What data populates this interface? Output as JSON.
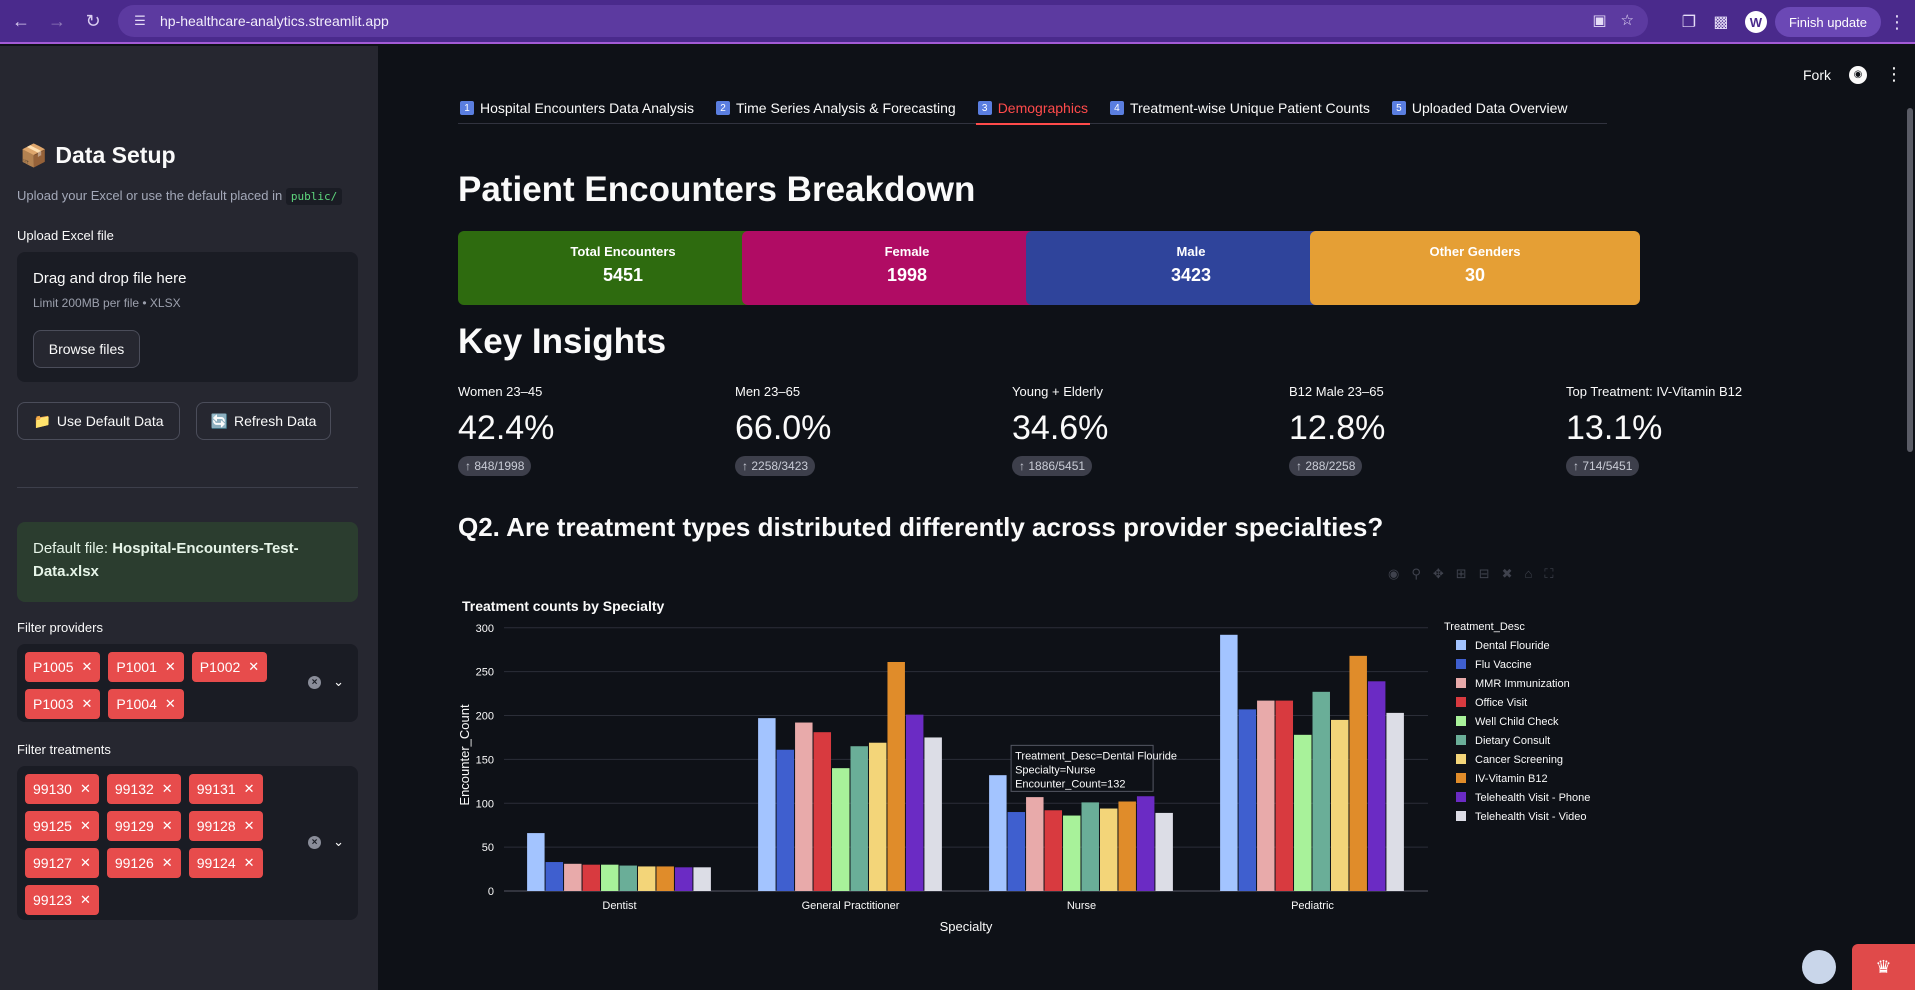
{
  "browser": {
    "url": "hp-healthcare-analytics.streamlit.app",
    "avatar_letter": "W",
    "finish_update": "Finish update"
  },
  "sidebar": {
    "title": "Data Setup",
    "caption": "Upload your Excel or use the default placed in",
    "caption_code": "public/",
    "upload_label": "Upload Excel file",
    "dropzone_title": "Drag and drop file here",
    "dropzone_limit": "Limit 200MB per file • XLSX",
    "browse_label": "Browse files",
    "use_default_label": "Use Default Data",
    "refresh_label": "Refresh Data",
    "default_file_prefix": "Default file:",
    "default_file_name": "Hospital-Encounters-Test-Data.xlsx",
    "filter_providers_label": "Filter providers",
    "providers": [
      "P1005",
      "P1001",
      "P1002",
      "P1003",
      "P1004"
    ],
    "filter_treatments_label": "Filter treatments",
    "treatments": [
      "99130",
      "99132",
      "99131",
      "99125",
      "99129",
      "99128",
      "99127",
      "99126",
      "99124",
      "99123"
    ]
  },
  "topbar": {
    "fork": "Fork"
  },
  "tabs": [
    {
      "num": "1",
      "label": "Hospital Encounters Data Analysis"
    },
    {
      "num": "2",
      "label": "Time Series Analysis & Forecasting"
    },
    {
      "num": "3",
      "label": "Demographics"
    },
    {
      "num": "4",
      "label": "Treatment-wise Unique Patient Counts"
    },
    {
      "num": "5",
      "label": "Uploaded Data Overview"
    }
  ],
  "main": {
    "heading": "Patient Encounters Breakdown",
    "cards": [
      {
        "label": "Total Encounters",
        "value": "5451",
        "color": "#2e6b0f"
      },
      {
        "label": "Female",
        "value": "1998",
        "color": "#b00c64"
      },
      {
        "label": "Male",
        "value": "3423",
        "color": "#2f449b"
      },
      {
        "label": "Other Genders",
        "value": "30",
        "color": "#e59f35"
      }
    ],
    "insights_heading": "Key Insights",
    "metrics": [
      {
        "label": "Women 23–45",
        "value": "42.4%",
        "delta": "848/1998"
      },
      {
        "label": "Men 23–65",
        "value": "66.0%",
        "delta": "2258/3423"
      },
      {
        "label": "Young + Elderly",
        "value": "34.6%",
        "delta": "1886/5451"
      },
      {
        "label": "B12 Male 23–65",
        "value": "12.8%",
        "delta": "288/2258"
      },
      {
        "label": "Top Treatment: IV-Vitamin B12",
        "value": "13.1%",
        "delta": "714/5451"
      }
    ],
    "question": "Q2. Are treatment types distributed differently across provider specialties?"
  },
  "chart_data": {
    "type": "bar",
    "title": "Treatment counts by Specialty",
    "xlabel": "Specialty",
    "ylabel": "Encounter_Count",
    "legend_title": "Treatment_Desc",
    "ylim": [
      0,
      310
    ],
    "yticks": [
      0,
      50,
      100,
      150,
      200,
      250,
      300
    ],
    "categories": [
      "Dentist",
      "General Practitioner",
      "Nurse",
      "Pediatric"
    ],
    "series": [
      {
        "name": "Dental Flouride",
        "color": "#a3c4ff",
        "values": [
          66,
          197,
          132,
          292
        ]
      },
      {
        "name": "Flu Vaccine",
        "color": "#3f5fcf",
        "values": [
          33,
          161,
          90,
          207
        ]
      },
      {
        "name": "MMR Immunization",
        "color": "#e8aaaa",
        "values": [
          31,
          192,
          107,
          217
        ]
      },
      {
        "name": "Office Visit",
        "color": "#d83a3f",
        "values": [
          30,
          181,
          92,
          217
        ]
      },
      {
        "name": "Well Child Check",
        "color": "#a8f29a",
        "values": [
          30,
          140,
          86,
          178
        ]
      },
      {
        "name": "Dietary Consult",
        "color": "#6aae98",
        "values": [
          29,
          165,
          101,
          227
        ]
      },
      {
        "name": "Cancer Screening",
        "color": "#f3d579",
        "values": [
          28,
          169,
          94,
          195
        ]
      },
      {
        "name": "IV-Vitamin B12",
        "color": "#e08c2a",
        "values": [
          28,
          261,
          102,
          268
        ]
      },
      {
        "name": "Telehealth Visit - Phone",
        "color": "#6b2bc4",
        "values": [
          27,
          201,
          108,
          239
        ]
      },
      {
        "name": "Telehealth Visit - Video",
        "color": "#dcdde6",
        "values": [
          27,
          175,
          89,
          203
        ]
      }
    ],
    "tooltip": {
      "line1": "Treatment_Desc=Dental Flouride",
      "line2": "Specialty=Nurse",
      "line3": "Encounter_Count=132"
    }
  }
}
